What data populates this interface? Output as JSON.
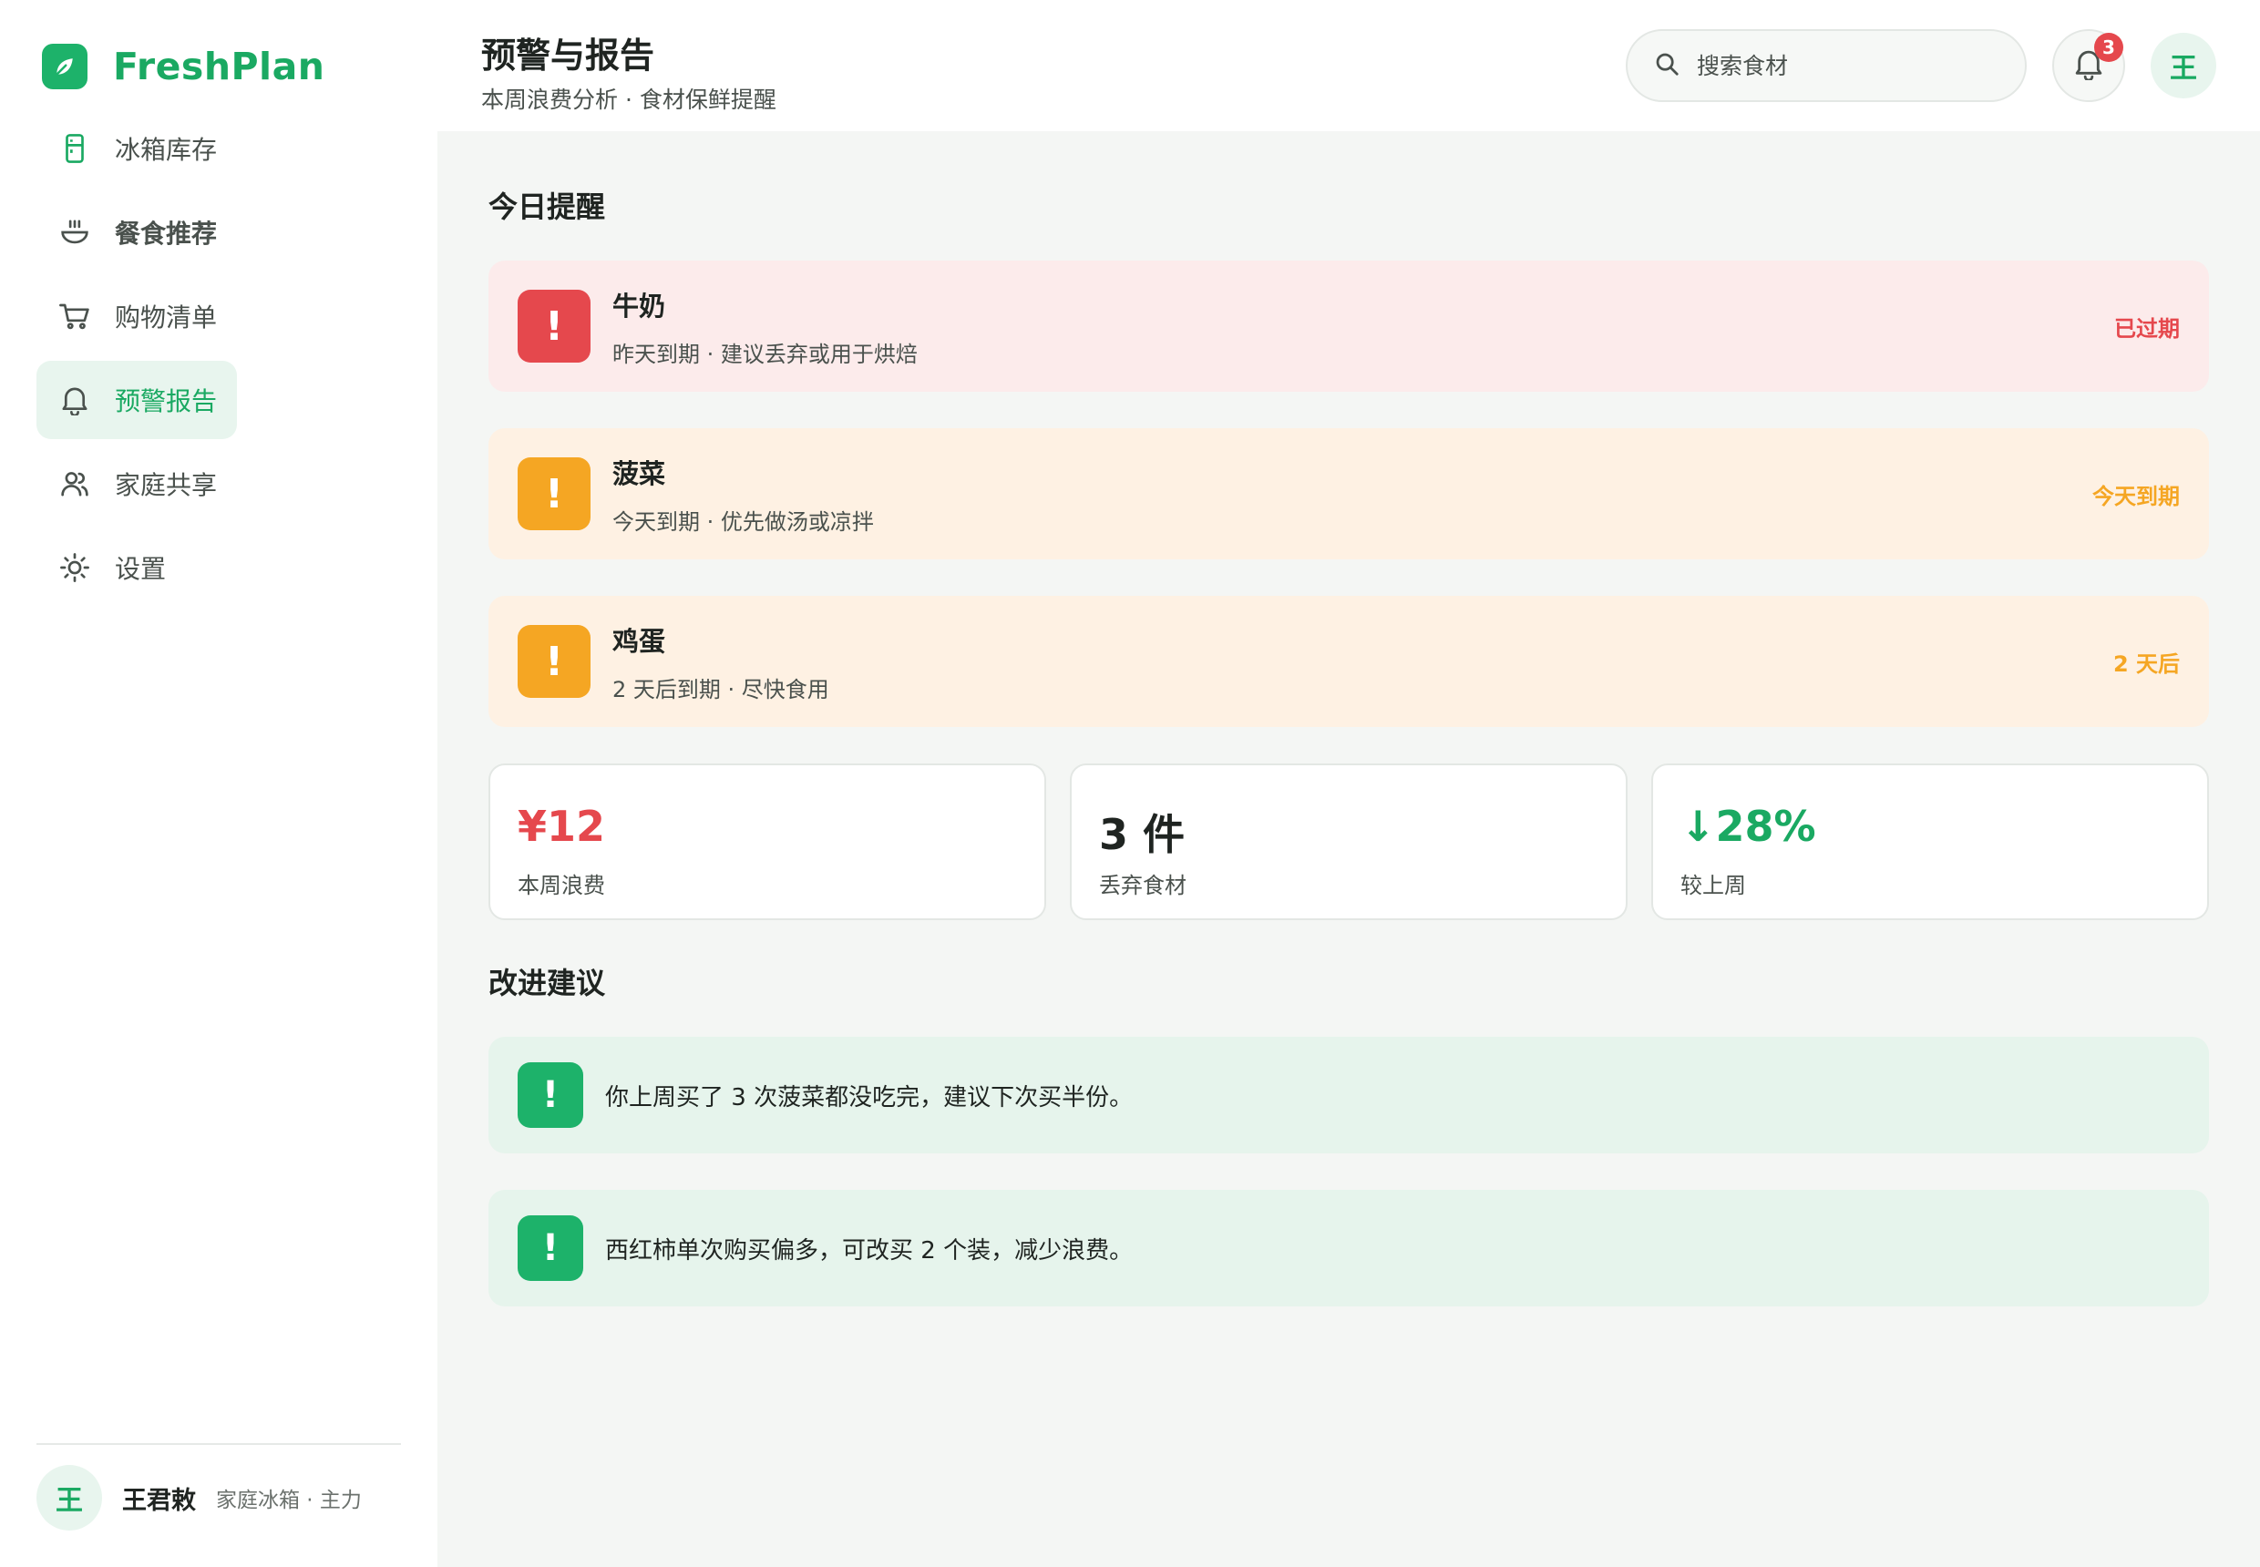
{
  "app": {
    "name": "FreshPlan",
    "brand_color": "#1db26a"
  },
  "sidebar": {
    "items": [
      {
        "label": "冰箱库存",
        "icon": "fridge-icon"
      },
      {
        "label": "餐食推荐",
        "icon": "bowl-icon"
      },
      {
        "label": "购物清单",
        "icon": "cart-icon"
      },
      {
        "label": "预警报告",
        "icon": "bell-icon",
        "active": true
      },
      {
        "label": "家庭共享",
        "icon": "users-icon"
      },
      {
        "label": "设置",
        "icon": "gear-icon"
      }
    ],
    "user": {
      "avatar": "王",
      "name": "王君敕",
      "role": "家庭冰箱 · 主力"
    }
  },
  "header": {
    "title": "预警与报告",
    "subtitle": "本周浪费分析 · 食材保鲜提醒",
    "search_placeholder": "搜索食材",
    "notification_count": "3",
    "avatar": "王"
  },
  "today": {
    "title": "今日提醒",
    "alerts": [
      {
        "icon": "!",
        "name": "牛奶",
        "desc": "昨天到期 · 建议丢弃或用于烘焙",
        "status": "已过期",
        "level": "expired",
        "color": "#e5484d"
      },
      {
        "icon": "!",
        "name": "菠菜",
        "desc": "今天到期 · 优先做汤或凉拌",
        "status": "今天到期",
        "level": "warning",
        "color": "#f5a623"
      },
      {
        "icon": "!",
        "name": "鸡蛋",
        "desc": "2 天后到期 · 尽快食用",
        "status": "2 天后",
        "level": "warning",
        "color": "#f5a623"
      }
    ]
  },
  "stats": [
    {
      "value": "¥12",
      "label": "本周浪费",
      "color": "#e5484d"
    },
    {
      "value": "3 件",
      "label": "丢弃食材",
      "color": "#1f2421"
    },
    {
      "value": "↓28%",
      "label": "较上周",
      "color": "#1aa962"
    }
  ],
  "suggestions": {
    "title": "改进建议",
    "items": [
      {
        "icon": "!",
        "text": "你上周买了 3 次菠菜都没吃完，建议下次买半份。"
      },
      {
        "icon": "!",
        "text": "西红柿单次购买偏多，可改买 2 个装，减少浪费。"
      }
    ]
  }
}
